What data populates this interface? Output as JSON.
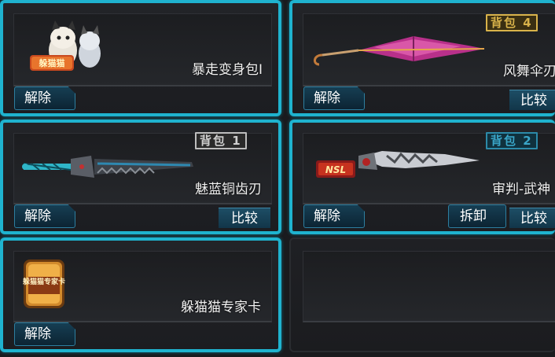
{
  "slots": [
    {
      "item_name": "暴走变身包I",
      "action_label": "解除"
    },
    {
      "item_name": "风舞伞刃",
      "action_label": "解除",
      "badge": "背包 4",
      "compare_label": "比较"
    },
    {
      "item_name": "魅蓝铜齿刃",
      "action_label": "解除",
      "badge": "背包 1",
      "compare_label": "比较"
    },
    {
      "item_name": "审判-武神",
      "action_label": "解除",
      "badge": "背包 2",
      "unequip_label": "拆卸",
      "compare_label": "比较",
      "logo_text": "NSL"
    },
    {
      "item_name": "躲猫猫专家卡",
      "action_label": "解除",
      "logo_text": "躲猫猫专家卡"
    }
  ],
  "colors": {
    "selected_border": "#1fb3cf",
    "badge_gold": "#d8b24a",
    "badge_white": "#cfcfcf",
    "badge_cyan": "#3aa6c8"
  }
}
